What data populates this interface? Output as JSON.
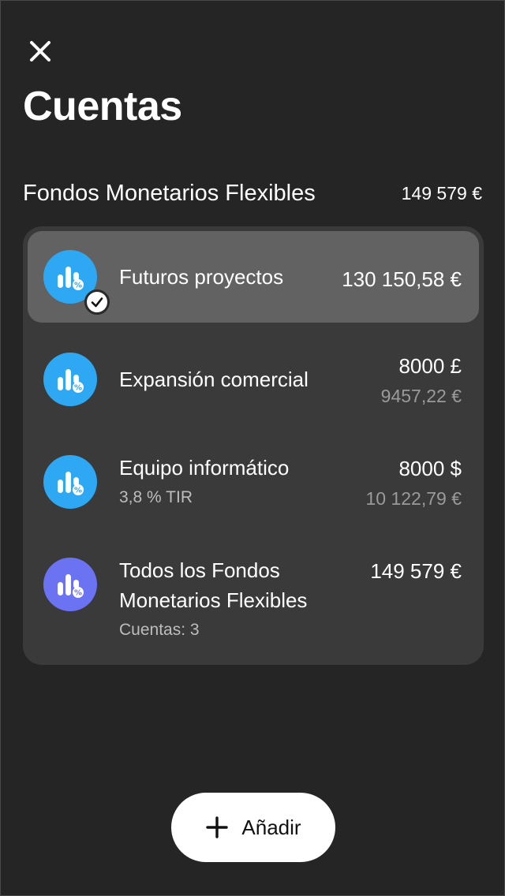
{
  "header": {
    "title": "Cuentas",
    "close_icon": "close-icon"
  },
  "section": {
    "title": "Fondos Monetarios Flexibles",
    "total": "149 579 €"
  },
  "accounts": [
    {
      "name": "Futuros proyectos",
      "amount": "130 150,58 €",
      "icon": "fund-chart-icon",
      "icon_color": "#2fa8f3",
      "selected": true
    },
    {
      "name": "Expansión comercial",
      "amount": "8000 £",
      "secondary_amount": "9457,22 €",
      "icon": "fund-chart-icon",
      "icon_color": "#2fa8f3"
    },
    {
      "name": "Equipo informático",
      "subtitle": "3,8 % TIR",
      "amount": "8000 $",
      "secondary_amount": "10 122,79 €",
      "icon": "fund-chart-icon",
      "icon_color": "#2fa8f3"
    },
    {
      "name_line1": "Todos los Fondos",
      "name_line2": "Monetarios Flexibles",
      "subtitle": "Cuentas: 3",
      "amount": "149 579 €",
      "icon": "fund-chart-icon",
      "icon_color": "#6b73f3"
    }
  ],
  "add_button": {
    "label": "Añadir",
    "icon": "plus-icon"
  },
  "colors": {
    "background": "#252525",
    "card": "#3a3a3a",
    "selected_row": "#626262",
    "accent_blue": "#2fa8f3",
    "accent_purple": "#6b73f3"
  }
}
